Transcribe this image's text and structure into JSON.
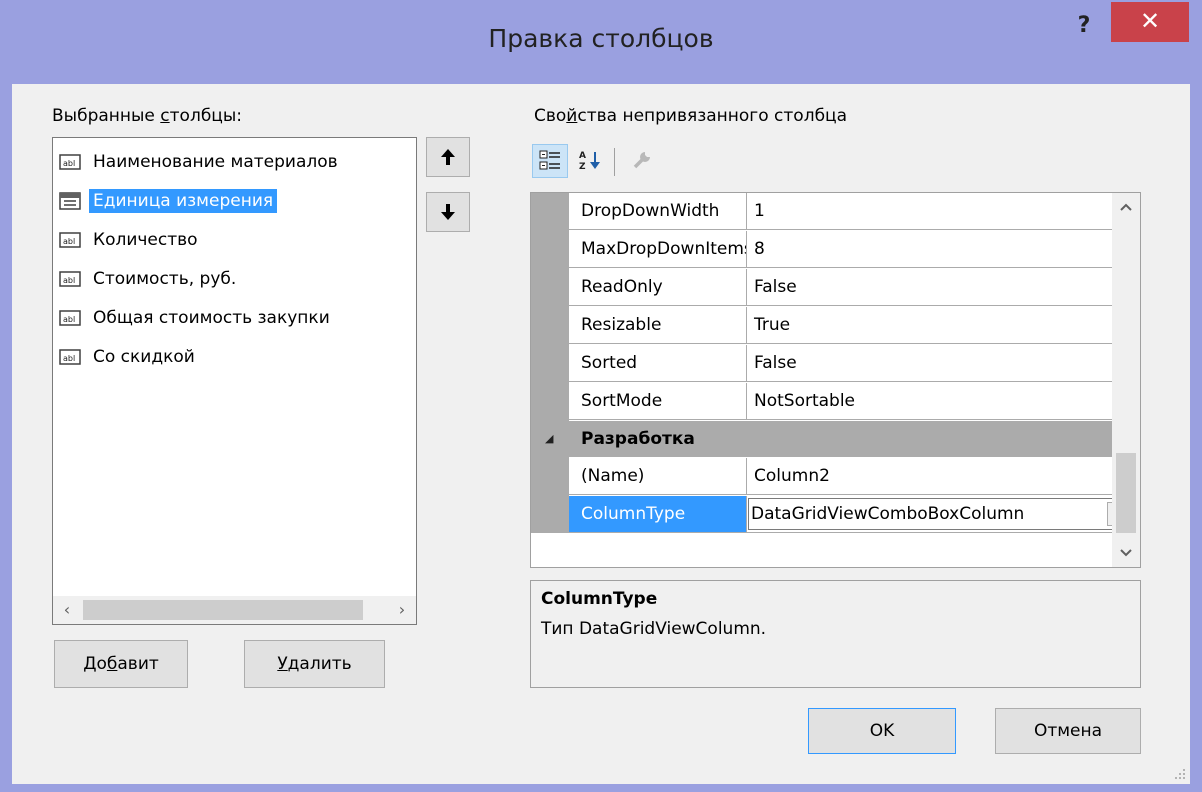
{
  "window": {
    "title": "Правка столбцов",
    "help_glyph": "?",
    "close_glyph": "✕"
  },
  "left": {
    "label_pre": "Выбранные ",
    "label_u": "с",
    "label_post": "толбцы:",
    "columns": [
      {
        "label": "Наименование материалов",
        "icon": "textbox-column-icon"
      },
      {
        "label": "Единица измерения",
        "icon": "combobox-column-icon",
        "selected": true
      },
      {
        "label": "Количество",
        "icon": "textbox-column-icon"
      },
      {
        "label": "Стоимость, руб.",
        "icon": "textbox-column-icon"
      },
      {
        "label": "Общая стоимость закупки",
        "icon": "textbox-column-icon"
      },
      {
        "label": "Со скидкой",
        "icon": "textbox-column-icon"
      }
    ],
    "scroll_left": "‹",
    "scroll_right": "›"
  },
  "buttons": {
    "add_pre": "До",
    "add_u": "б",
    "add_post": "авит",
    "remove_u": "У",
    "remove_post": "далить",
    "ok": "OK",
    "cancel": "Отмена"
  },
  "right": {
    "label_pre": "Сво",
    "label_u": "й",
    "label_post": "ства непривязанного столбца",
    "properties": [
      {
        "name": "DropDownWidth",
        "value": "1"
      },
      {
        "name": "MaxDropDownItems",
        "value": "8"
      },
      {
        "name": "ReadOnly",
        "value": "False"
      },
      {
        "name": "Resizable",
        "value": "True"
      },
      {
        "name": "Sorted",
        "value": "False"
      },
      {
        "name": "SortMode",
        "value": "NotSortable"
      }
    ],
    "category": {
      "glyph": "◢",
      "name": "Разработка"
    },
    "design_properties": [
      {
        "name": "(Name)",
        "value": "Column2"
      },
      {
        "name": "ColumnType",
        "value": "DataGridViewComboBoxColumn",
        "selected": true
      }
    ],
    "help_title": "ColumnType",
    "help_desc": "Тип DataGridViewColumn."
  }
}
